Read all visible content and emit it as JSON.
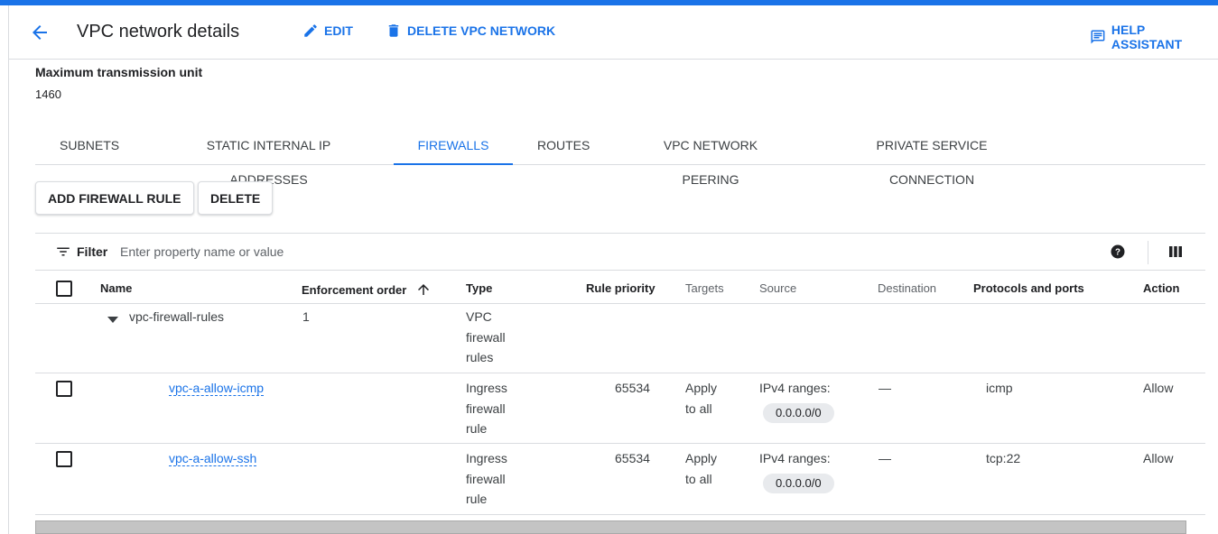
{
  "header": {
    "title": "VPC network details",
    "edit_label": "EDIT",
    "delete_network_label": "DELETE VPC NETWORK",
    "help_assistant_label": "HELP ASSISTANT"
  },
  "mtu": {
    "label": "Maximum transmission unit",
    "value": "1460"
  },
  "tabs": [
    {
      "label": "SUBNETS",
      "active": false
    },
    {
      "label": "STATIC INTERNAL IP ADDRESSES",
      "active": false
    },
    {
      "label": "FIREWALLS",
      "active": true
    },
    {
      "label": "ROUTES",
      "active": false
    },
    {
      "label": "VPC NETWORK PEERING",
      "active": false
    },
    {
      "label": "PRIVATE SERVICE CONNECTION",
      "active": false
    }
  ],
  "actions": {
    "add_rule_label": "ADD FIREWALL RULE",
    "delete_label": "DELETE"
  },
  "filter": {
    "label": "Filter",
    "placeholder": "Enter property name or value"
  },
  "table": {
    "columns": [
      "Name",
      "Enforcement order",
      "Type",
      "Rule priority",
      "Targets",
      "Source",
      "Destination",
      "Protocols and ports",
      "Action"
    ],
    "sort_column": "Enforcement order",
    "sort_direction": "ascending",
    "group": {
      "name": "vpc-firewall-rules",
      "enforcement_order": "1",
      "type_lines": [
        "VPC",
        "firewall",
        "rules"
      ]
    },
    "rows": [
      {
        "name": "vpc-a-allow-icmp",
        "type_lines": [
          "Ingress",
          "firewall",
          "rule"
        ],
        "priority": "65534",
        "targets_lines": [
          "Apply",
          "to all"
        ],
        "source_label": "IPv4 ranges:",
        "source_chip": "0.0.0.0/0",
        "destination": "—",
        "protocols": "icmp",
        "action": "Allow"
      },
      {
        "name": "vpc-a-allow-ssh",
        "type_lines": [
          "Ingress",
          "firewall",
          "rule"
        ],
        "priority": "65534",
        "targets_lines": [
          "Apply",
          "to all"
        ],
        "source_label": "IPv4 ranges:",
        "source_chip": "0.0.0.0/0",
        "destination": "—",
        "protocols": "tcp:22",
        "action": "Allow"
      }
    ]
  },
  "colors": {
    "accent": "#1a73e8",
    "text": "#202124",
    "muted": "#5f6368",
    "divider": "#dadce0",
    "chip_bg": "#e8eaed"
  },
  "icons": {
    "back": "arrow-left-icon",
    "edit": "pencil-icon",
    "delete": "trash-icon",
    "help_assistant": "chat-icon",
    "filter": "filter-lines-icon",
    "help": "question-circle-icon",
    "columns": "column-display-icon",
    "sort": "arrow-up-icon",
    "expand": "triangle-down-icon"
  }
}
